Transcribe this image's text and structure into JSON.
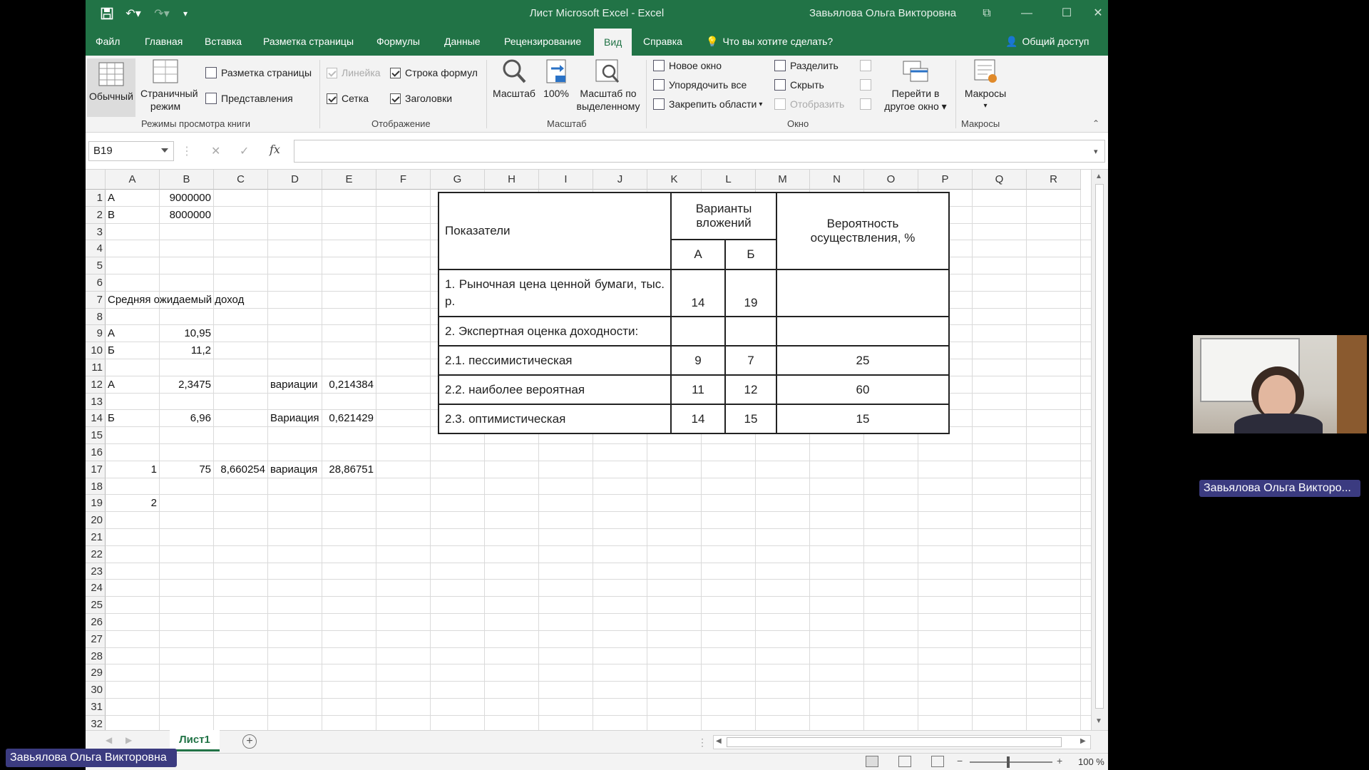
{
  "app": {
    "doc_title": "Лист Microsoft Excel  -  Excel",
    "user_name": "Завьялова Ольга Викторовна"
  },
  "tabs": [
    "Файл",
    "Главная",
    "Вставка",
    "Разметка страницы",
    "Формулы",
    "Данные",
    "Рецензирование",
    "Вид",
    "Справка"
  ],
  "active_tab": "Вид",
  "tellme": "Что вы хотите сделать?",
  "share": "Общий доступ",
  "ribbon": {
    "views": {
      "normal": "Обычный",
      "page_break": "Страничный режим",
      "page_layout": "Разметка страницы",
      "custom_views": "Представления",
      "group_label": "Режимы просмотра книги"
    },
    "show": {
      "ruler": "Линейка",
      "formula_bar": "Строка формул",
      "gridlines": "Сетка",
      "headings": "Заголовки",
      "group_label": "Отображение"
    },
    "zoom": {
      "zoom": "Масштаб",
      "zoom100": "100%",
      "zoom_sel": "Масштаб по выделенному",
      "group_label": "Масштаб"
    },
    "window": {
      "new_window": "Новое окно",
      "arrange_all": "Упорядочить все",
      "freeze_panes": "Закрепить области",
      "split": "Разделить",
      "hide": "Скрыть",
      "unhide": "Отобразить",
      "switch_windows": "Перейти в другое окно",
      "group_label": "Окно"
    },
    "macros": {
      "macros": "Макросы",
      "group_label": "Макросы"
    }
  },
  "formula_bar": {
    "name_box": "B19",
    "formula": ""
  },
  "columns": [
    "A",
    "B",
    "C",
    "D",
    "E",
    "F",
    "G",
    "H",
    "I",
    "J",
    "K",
    "L",
    "M",
    "N",
    "O",
    "P",
    "Q",
    "R"
  ],
  "rows": [
    "1",
    "2",
    "3",
    "4",
    "5",
    "6",
    "7",
    "8",
    "9",
    "10",
    "11",
    "12",
    "13",
    "14",
    "15",
    "16",
    "17",
    "18",
    "19",
    "20",
    "21",
    "22",
    "23",
    "24",
    "25",
    "26",
    "27",
    "28",
    "29",
    "30",
    "31",
    "32"
  ],
  "cells": {
    "A1": "А",
    "B1": "9000000",
    "A2": "В",
    "B2": "8000000",
    "A7": "Средняя ожидаемый доход",
    "A9": "А",
    "B9": "10,95",
    "A10": "Б",
    "B10": "11,2",
    "A12": "А",
    "B12": "2,3475",
    "D12": "вариации",
    "E12": "0,214384",
    "A14": "Б",
    "B14": "6,96",
    "D14": "Вариация",
    "E14": "0,621429",
    "A17": "1",
    "B17": "75",
    "C17": "8,660254",
    "D17": "вариация",
    "E17": "28,86751",
    "A19": "2"
  },
  "embedded_table": {
    "h_indicators": "Показатели",
    "h_variants": "Варианты вложений",
    "h_probability": "Вероятность осуществления, %",
    "h_a": "А",
    "h_b": "Б",
    "r1_label": "1.  Рыночная  цена  ценной  бумаги, тыс. р.",
    "r1_a": "14",
    "r1_b": "19",
    "r1_p": "",
    "r2_label": "2. Экспертная оценка доходности:",
    "r3_label": "2.1. пессимистическая",
    "r3_a": "9",
    "r3_b": "7",
    "r3_p": "25",
    "r4_label": "2.2. наиболее вероятная",
    "r4_a": "11",
    "r4_b": "12",
    "r4_p": "60",
    "r5_label": "2.3. оптимистическая",
    "r5_a": "14",
    "r5_b": "15",
    "r5_p": "15"
  },
  "sheet_tab": "Лист1",
  "zoom_level": "100 %",
  "overlay": {
    "webcam_label": "Завьялова Ольга Викторо...",
    "presenter_label": "Завьялова Ольга Викторовна"
  }
}
